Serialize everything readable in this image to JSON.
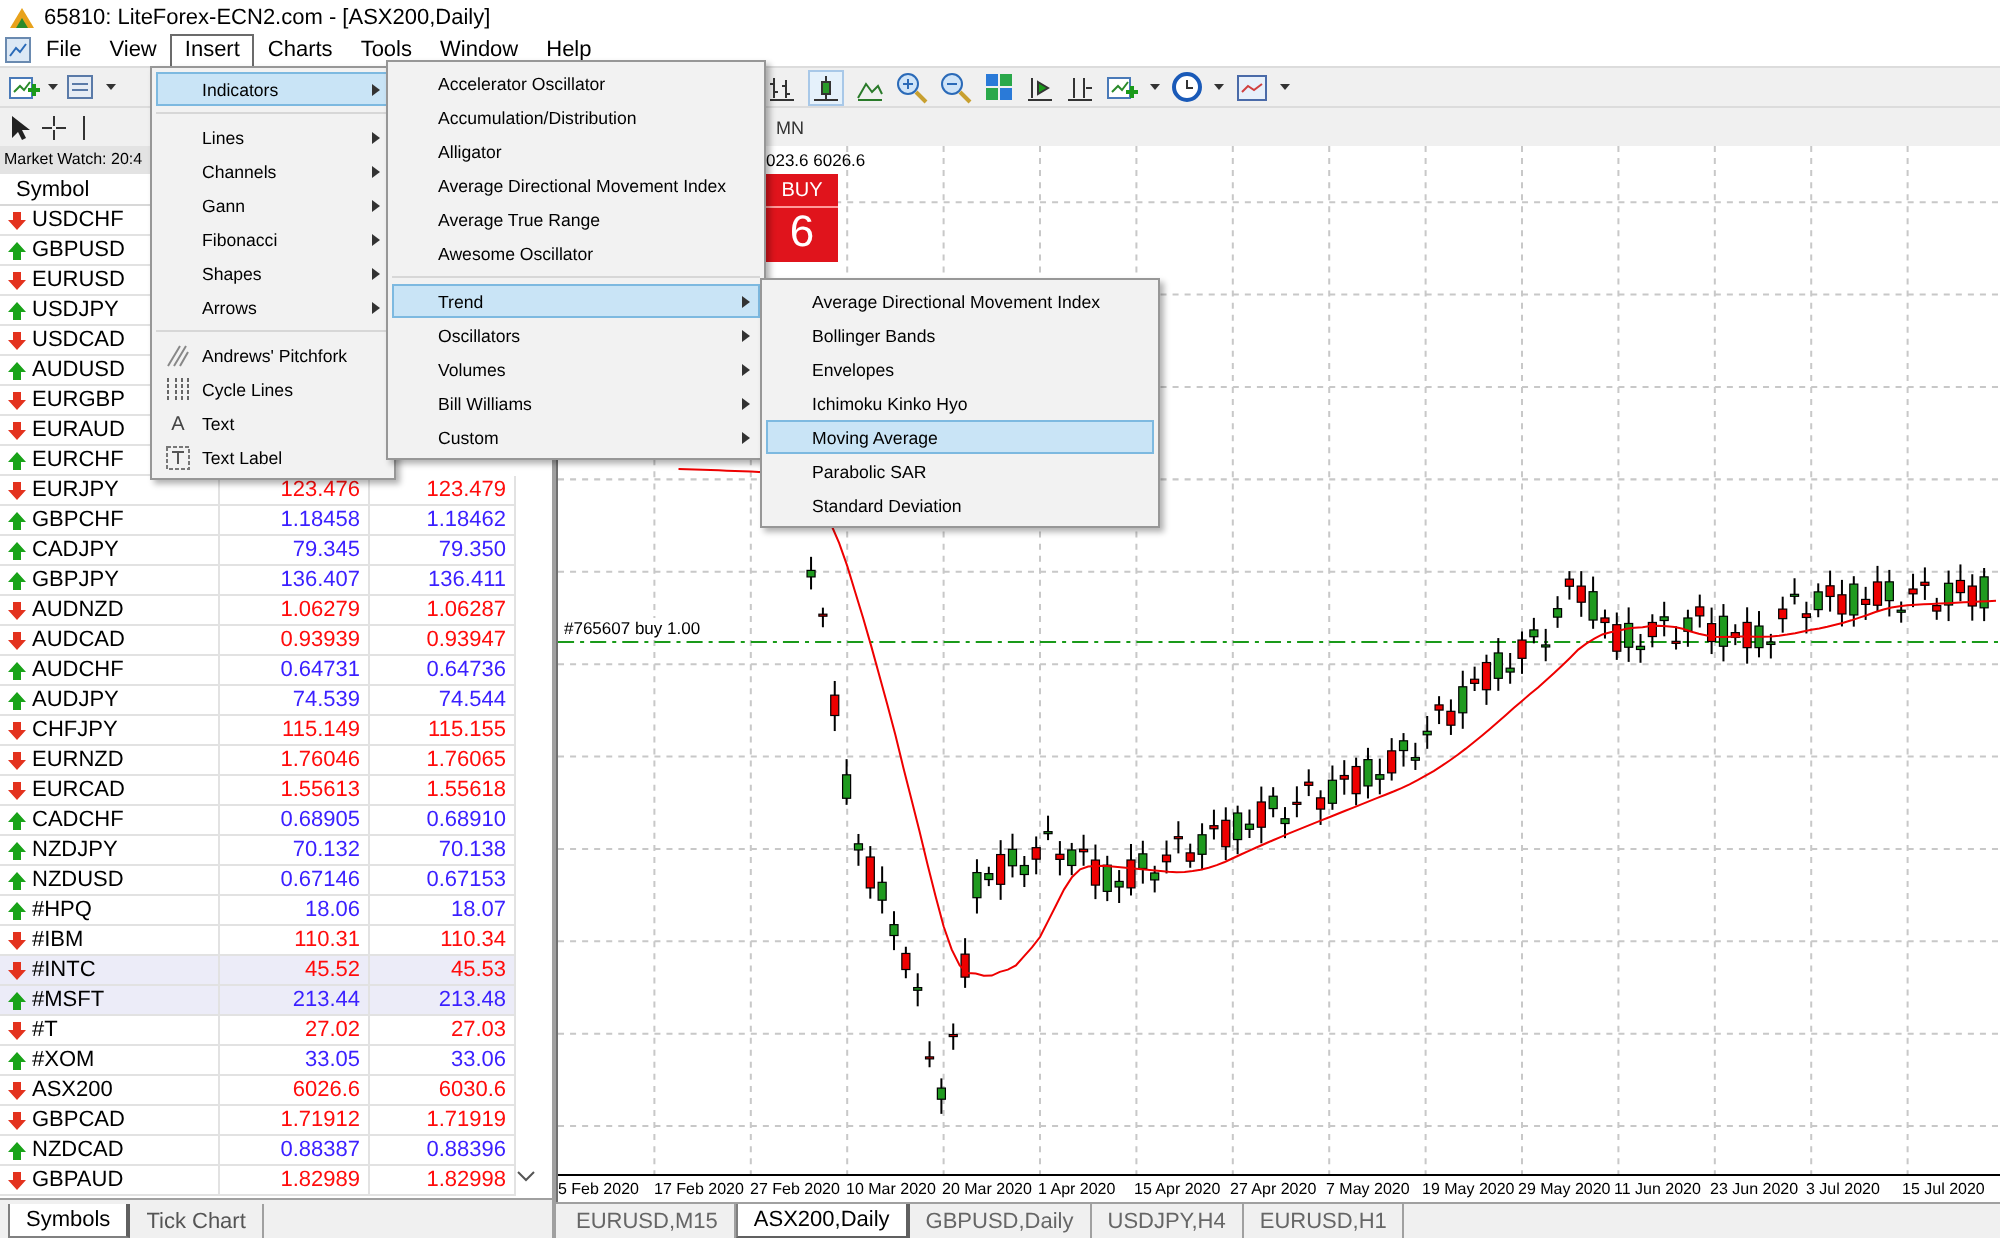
{
  "window": {
    "title": "65810: LiteForex-ECN2.com - [ASX200,Daily]"
  },
  "menu_bar": [
    {
      "label": "File",
      "selected": false
    },
    {
      "label": "View",
      "selected": false
    },
    {
      "label": "Insert",
      "selected": true
    },
    {
      "label": "Charts",
      "selected": false
    },
    {
      "label": "Tools",
      "selected": false
    },
    {
      "label": "Window",
      "selected": false
    },
    {
      "label": "Help",
      "selected": false
    }
  ],
  "timeframes": [
    "MN"
  ],
  "market_watch": {
    "title": "Market Watch: 20:4",
    "columns": [
      "Symbol"
    ],
    "rows": [
      {
        "symbol": "USDCHF",
        "kind": "down",
        "selected": false
      },
      {
        "symbol": "GBPUSD",
        "kind": "up",
        "selected": false
      },
      {
        "symbol": "EURUSD",
        "kind": "down",
        "selected": false
      },
      {
        "symbol": "USDJPY",
        "kind": "up",
        "selected": false
      },
      {
        "symbol": "USDCAD",
        "kind": "down",
        "selected": false
      },
      {
        "symbol": "AUDUSD",
        "kind": "up",
        "selected": false
      },
      {
        "symbol": "EURGBP",
        "kind": "down",
        "selected": false
      },
      {
        "symbol": "EURAUD",
        "kind": "down",
        "selected": false
      },
      {
        "symbol": "EURCHF",
        "kind": "up",
        "selected": false
      },
      {
        "symbol": "EURJPY",
        "kind": "down",
        "selected": false,
        "bid": "123.476",
        "ask": "123.479"
      },
      {
        "symbol": "GBPCHF",
        "kind": "up",
        "selected": false,
        "bid": "1.18458",
        "ask": "1.18462"
      },
      {
        "symbol": "CADJPY",
        "kind": "up",
        "selected": false,
        "bid": "79.345",
        "ask": "79.350"
      },
      {
        "symbol": "GBPJPY",
        "kind": "up",
        "selected": false,
        "bid": "136.407",
        "ask": "136.411"
      },
      {
        "symbol": "AUDNZD",
        "kind": "down",
        "selected": false,
        "bid": "1.06279",
        "ask": "1.06287"
      },
      {
        "symbol": "AUDCAD",
        "kind": "down",
        "selected": false,
        "bid": "0.93939",
        "ask": "0.93947"
      },
      {
        "symbol": "AUDCHF",
        "kind": "up",
        "selected": false,
        "bid": "0.64731",
        "ask": "0.64736"
      },
      {
        "symbol": "AUDJPY",
        "kind": "up",
        "selected": false,
        "bid": "74.539",
        "ask": "74.544"
      },
      {
        "symbol": "CHFJPY",
        "kind": "down",
        "selected": false,
        "bid": "115.149",
        "ask": "115.155"
      },
      {
        "symbol": "EURNZD",
        "kind": "down",
        "selected": false,
        "bid": "1.76046",
        "ask": "1.76065"
      },
      {
        "symbol": "EURCAD",
        "kind": "down",
        "selected": false,
        "bid": "1.55613",
        "ask": "1.55618"
      },
      {
        "symbol": "CADCHF",
        "kind": "up",
        "selected": false,
        "bid": "0.68905",
        "ask": "0.68910"
      },
      {
        "symbol": "NZDJPY",
        "kind": "up",
        "selected": false,
        "bid": "70.132",
        "ask": "70.138"
      },
      {
        "symbol": "NZDUSD",
        "kind": "up",
        "selected": false,
        "bid": "0.67146",
        "ask": "0.67153"
      },
      {
        "symbol": "#HPQ",
        "kind": "up",
        "selected": false,
        "bid": "18.06",
        "ask": "18.07"
      },
      {
        "symbol": "#IBM",
        "kind": "down",
        "selected": false,
        "bid": "110.31",
        "ask": "110.34"
      },
      {
        "symbol": "#INTC",
        "kind": "down",
        "selected": true,
        "bid": "45.52",
        "ask": "45.53"
      },
      {
        "symbol": "#MSFT",
        "kind": "up",
        "selected": true,
        "bid": "213.44",
        "ask": "213.48"
      },
      {
        "symbol": "#T",
        "kind": "down",
        "selected": false,
        "bid": "27.02",
        "ask": "27.03"
      },
      {
        "symbol": "#XOM",
        "kind": "up",
        "selected": false,
        "bid": "33.05",
        "ask": "33.06"
      },
      {
        "symbol": "ASX200",
        "kind": "down",
        "selected": false,
        "bid": "6026.6",
        "ask": "6030.6"
      },
      {
        "symbol": "GBPCAD",
        "kind": "down",
        "selected": false,
        "bid": "1.71912",
        "ask": "1.71919"
      },
      {
        "symbol": "NZDCAD",
        "kind": "up",
        "selected": false,
        "bid": "0.88387",
        "ask": "0.88396"
      },
      {
        "symbol": "GBPAUD",
        "kind": "down",
        "selected": false,
        "bid": "1.82989",
        "ask": "1.82998"
      }
    ],
    "tabs": [
      {
        "label": "Symbols",
        "selected": true
      },
      {
        "label": "Tick Chart",
        "selected": false
      }
    ]
  },
  "chart": {
    "price_header": "023.6 6026.6",
    "trade_panel": {
      "label": "BUY",
      "price": "6"
    },
    "order_line": "#765607 buy 1.00",
    "x_axis_labels": [
      "5 Feb 2020",
      "17 Feb 2020",
      "27 Feb 2020",
      "10 Mar 2020",
      "20 Mar 2020",
      "1 Apr 2020",
      "15 Apr 2020",
      "27 Apr 2020",
      "7 May 2020",
      "19 May 2020",
      "29 May 2020",
      "11 Jun 2020",
      "23 Jun 2020",
      "3 Jul 2020",
      "15 Jul 2020"
    ]
  },
  "chart_tabs": [
    {
      "label": "EURUSD,M15",
      "selected": false
    },
    {
      "label": "ASX200,Daily",
      "selected": true
    },
    {
      "label": "GBPUSD,Daily",
      "selected": false
    },
    {
      "label": "USDJPY,H4",
      "selected": false
    },
    {
      "label": "EURUSD,H1",
      "selected": false
    }
  ],
  "insert_menu": [
    {
      "kind": "submenu",
      "label": "Indicators",
      "selected": true
    },
    {
      "kind": "separator"
    },
    {
      "kind": "submenu",
      "label": "Lines",
      "selected": false
    },
    {
      "kind": "submenu",
      "label": "Channels",
      "selected": false
    },
    {
      "kind": "submenu",
      "label": "Gann",
      "selected": false
    },
    {
      "kind": "submenu",
      "label": "Fibonacci",
      "selected": false
    },
    {
      "kind": "submenu",
      "label": "Shapes",
      "selected": false
    },
    {
      "kind": "submenu",
      "label": "Arrows",
      "selected": false
    },
    {
      "kind": "separator"
    },
    {
      "kind": "pitchfork",
      "label": "Andrews' Pitchfork",
      "selected": false
    },
    {
      "kind": "cycles",
      "label": "Cycle Lines",
      "selected": false
    },
    {
      "kind": "text",
      "glyph": "A",
      "label": "Text",
      "selected": false
    },
    {
      "kind": "textlabel",
      "label": "Text Label",
      "selected": false
    }
  ],
  "indicators_menu": [
    {
      "kind": "item",
      "label": "Accelerator Oscillator",
      "selected": false
    },
    {
      "kind": "item",
      "label": "Accumulation/Distribution",
      "selected": false
    },
    {
      "kind": "item",
      "label": "Alligator",
      "selected": false
    },
    {
      "kind": "item",
      "label": "Average Directional Movement Index",
      "selected": false
    },
    {
      "kind": "item",
      "label": "Average True Range",
      "selected": false
    },
    {
      "kind": "item",
      "label": "Awesome Oscillator",
      "selected": false
    },
    {
      "kind": "separator"
    },
    {
      "kind": "submenu",
      "label": "Trend",
      "selected": true
    },
    {
      "kind": "submenu",
      "label": "Oscillators",
      "selected": false
    },
    {
      "kind": "submenu",
      "label": "Volumes",
      "selected": false
    },
    {
      "kind": "submenu",
      "label": "Bill Williams",
      "selected": false
    },
    {
      "kind": "submenu",
      "label": "Custom",
      "selected": false
    }
  ],
  "trend_menu": [
    {
      "kind": "item",
      "label": "Average Directional Movement Index",
      "selected": false
    },
    {
      "kind": "item",
      "label": "Bollinger Bands",
      "selected": false
    },
    {
      "kind": "item",
      "label": "Envelopes",
      "selected": false
    },
    {
      "kind": "item",
      "label": "Ichimoku Kinko Hyo",
      "selected": false
    },
    {
      "kind": "item",
      "label": "Moving Average",
      "selected": true
    },
    {
      "kind": "item",
      "label": "Parabolic SAR",
      "selected": false
    },
    {
      "kind": "item",
      "label": "Standard Deviation",
      "selected": false
    }
  ]
}
